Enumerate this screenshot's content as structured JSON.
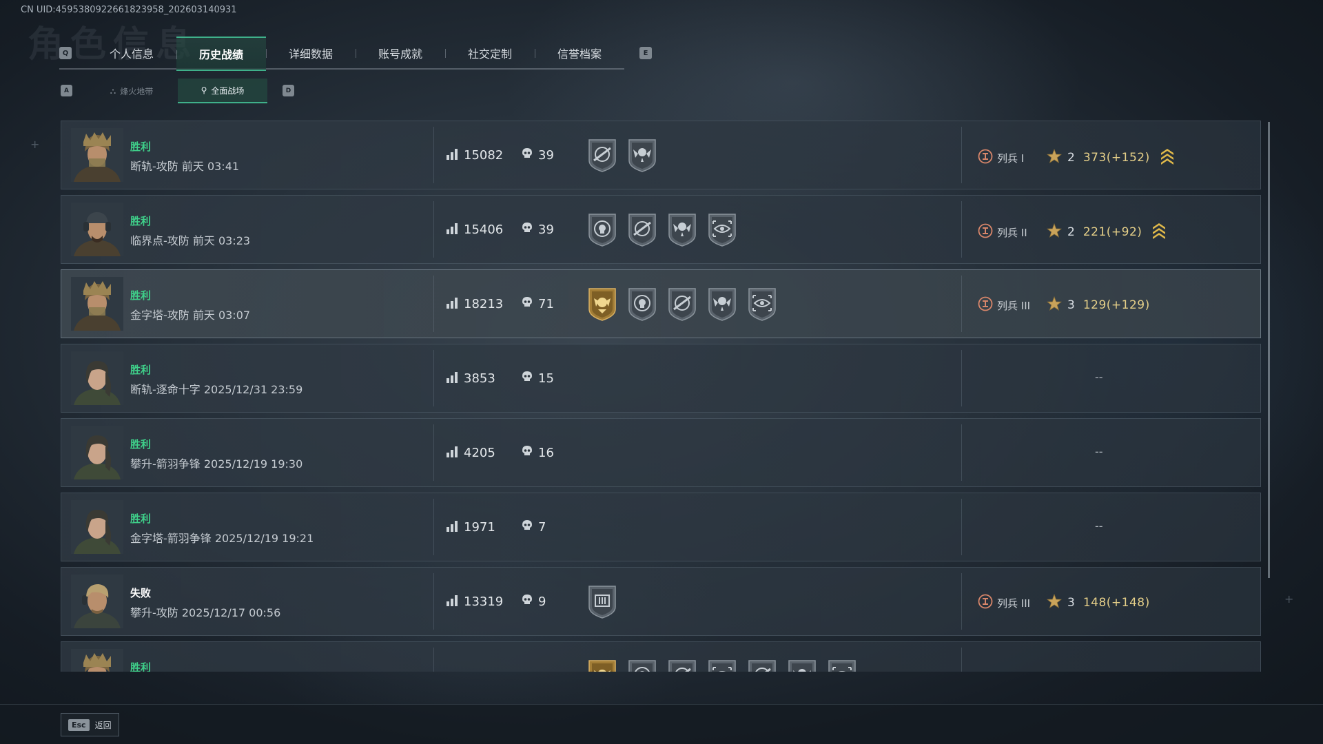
{
  "uid_text": "CN UID:4595380922661823958_202603140931",
  "watermark": "角色信息",
  "tabs": {
    "prev_key": "Q",
    "next_key": "E",
    "items": [
      {
        "label": "个人信息"
      },
      {
        "label": "历史战绩",
        "active": true
      },
      {
        "label": "详细数据"
      },
      {
        "label": "账号成就"
      },
      {
        "label": "社交定制"
      },
      {
        "label": "信誉档案"
      }
    ]
  },
  "subtabs": {
    "prev_key": "A",
    "next_key": "D",
    "items": [
      {
        "label": "烽火地带"
      },
      {
        "label": "全面战场",
        "active": true
      }
    ]
  },
  "matches": [
    {
      "result": "胜利",
      "subtitle": "断轨-攻防 前天 03:41",
      "score": "15082",
      "kills": "39",
      "medals": [
        "crosshair-rifle-badge",
        "skull-wings-badge"
      ],
      "rank": "列兵 I",
      "rank_numeral": "I",
      "level": "2",
      "points": "373(+152)",
      "promo": true,
      "avatar": "helmet"
    },
    {
      "result": "胜利",
      "subtitle": "临界点-攻防 前天 03:23",
      "score": "15406",
      "kills": "39",
      "medals": [
        "skull-target-badge",
        "crosshair-rifle-badge",
        "skull-wings-badge",
        "eye-target-badge"
      ],
      "rank": "列兵 II",
      "rank_numeral": "II",
      "level": "2",
      "points": "221(+92)",
      "promo": true,
      "avatar": "cap"
    },
    {
      "result": "胜利",
      "subtitle": "金字塔-攻防 前天 03:07",
      "score": "18213",
      "kills": "71",
      "medals": [
        "gold-crest-badge",
        "skull-target-badge",
        "crosshair-rifle-badge",
        "skull-wings-badge",
        "eye-target-badge"
      ],
      "rank": "列兵 III",
      "rank_numeral": "III",
      "level": "3",
      "points": "129(+129)",
      "promo": false,
      "avatar": "helmet",
      "highlight": true
    },
    {
      "result": "胜利",
      "subtitle": "断轨-逐命十字 2025/12/31 23:59",
      "score": "3853",
      "kills": "15",
      "medals": [],
      "rank": null,
      "empty_text": "--",
      "avatar": "female"
    },
    {
      "result": "胜利",
      "subtitle": "攀升-箭羽争锋 2025/12/19 19:30",
      "score": "4205",
      "kills": "16",
      "medals": [],
      "rank": null,
      "empty_text": "--",
      "avatar": "female"
    },
    {
      "result": "胜利",
      "subtitle": "金字塔-箭羽争锋 2025/12/19 19:21",
      "score": "1971",
      "kills": "7",
      "medals": [],
      "rank": null,
      "empty_text": "--",
      "avatar": "female"
    },
    {
      "result": "失败",
      "subtitle": "攀升-攻防 2025/12/17 00:56",
      "score": "13319",
      "kills": "9",
      "medals": [
        "supply-box-badge"
      ],
      "rank": "列兵 III",
      "rank_numeral": "III",
      "level": "3",
      "points": "148(+148)",
      "promo": false,
      "avatar": "blond",
      "lose": true
    },
    {
      "result": "胜利",
      "subtitle": "",
      "score": "",
      "kills": "",
      "medals": [
        "gold-crest-badge",
        "skull-target-badge",
        "crosshair-rifle-badge",
        "eye-target-badge",
        "crosshair-rifle-badge",
        "skull-wings-badge",
        "eye-target-badge"
      ],
      "rank": null,
      "empty_text": "",
      "avatar": "helmet",
      "partial": true
    }
  ],
  "footer": {
    "esc_key": "Esc",
    "back_label": "返回"
  },
  "colors": {
    "accent": "#3fb08a",
    "victory": "#3fd08a",
    "points": "#e6d089",
    "rank": "#d8866a"
  }
}
